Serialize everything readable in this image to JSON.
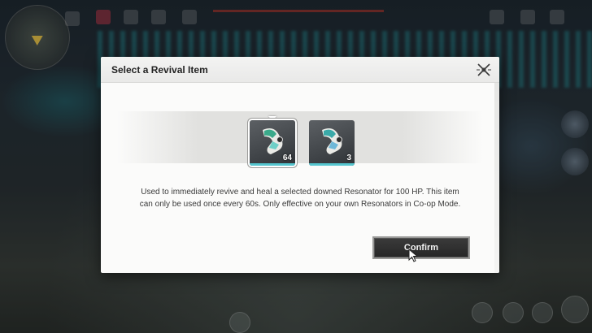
{
  "dialog": {
    "title": "Select a Revival Item",
    "close_icon": "close-x-icon",
    "items": [
      {
        "icon": "revival-capsule-icon",
        "count": "64",
        "selected": true
      },
      {
        "icon": "revival-capsule-icon",
        "count": "3",
        "selected": false
      }
    ],
    "description": "Used to immediately revive and heal a selected downed Resonator for 100 HP. This item can only be used once every 60s. Only effective on your own Resonators in Co-op Mode.",
    "confirm_label": "Confirm"
  },
  "colors": {
    "accent_cyan": "#55c6cf",
    "dialog_bg": "#fbfbfa",
    "button_bg": "#2f2f2f"
  }
}
